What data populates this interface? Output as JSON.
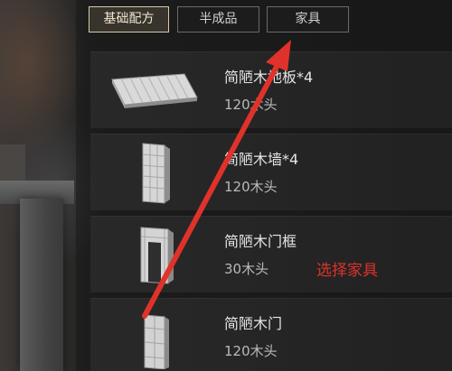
{
  "tabs": [
    {
      "label": "基础配方",
      "active": true
    },
    {
      "label": "半成品",
      "active": false
    },
    {
      "label": "家具",
      "active": false
    }
  ],
  "recipes": [
    {
      "name": "简陋木地板*4",
      "cost": "120木头",
      "icon": "wood-floor-icon"
    },
    {
      "name": "简陋木墙*4",
      "cost": "120木头",
      "icon": "wood-wall-icon"
    },
    {
      "name": "简陋木门框",
      "cost": "30木头",
      "icon": "wood-doorframe-icon"
    },
    {
      "name": "简陋木门",
      "cost": "120木头",
      "icon": "wood-door-icon"
    }
  ],
  "annotation": {
    "text": "选择家具",
    "color": "#e0322a"
  },
  "colors": {
    "tab_active_border": "#d8c9a8",
    "card_bg": "#2a2a2a",
    "arrow": "#e0322a"
  }
}
